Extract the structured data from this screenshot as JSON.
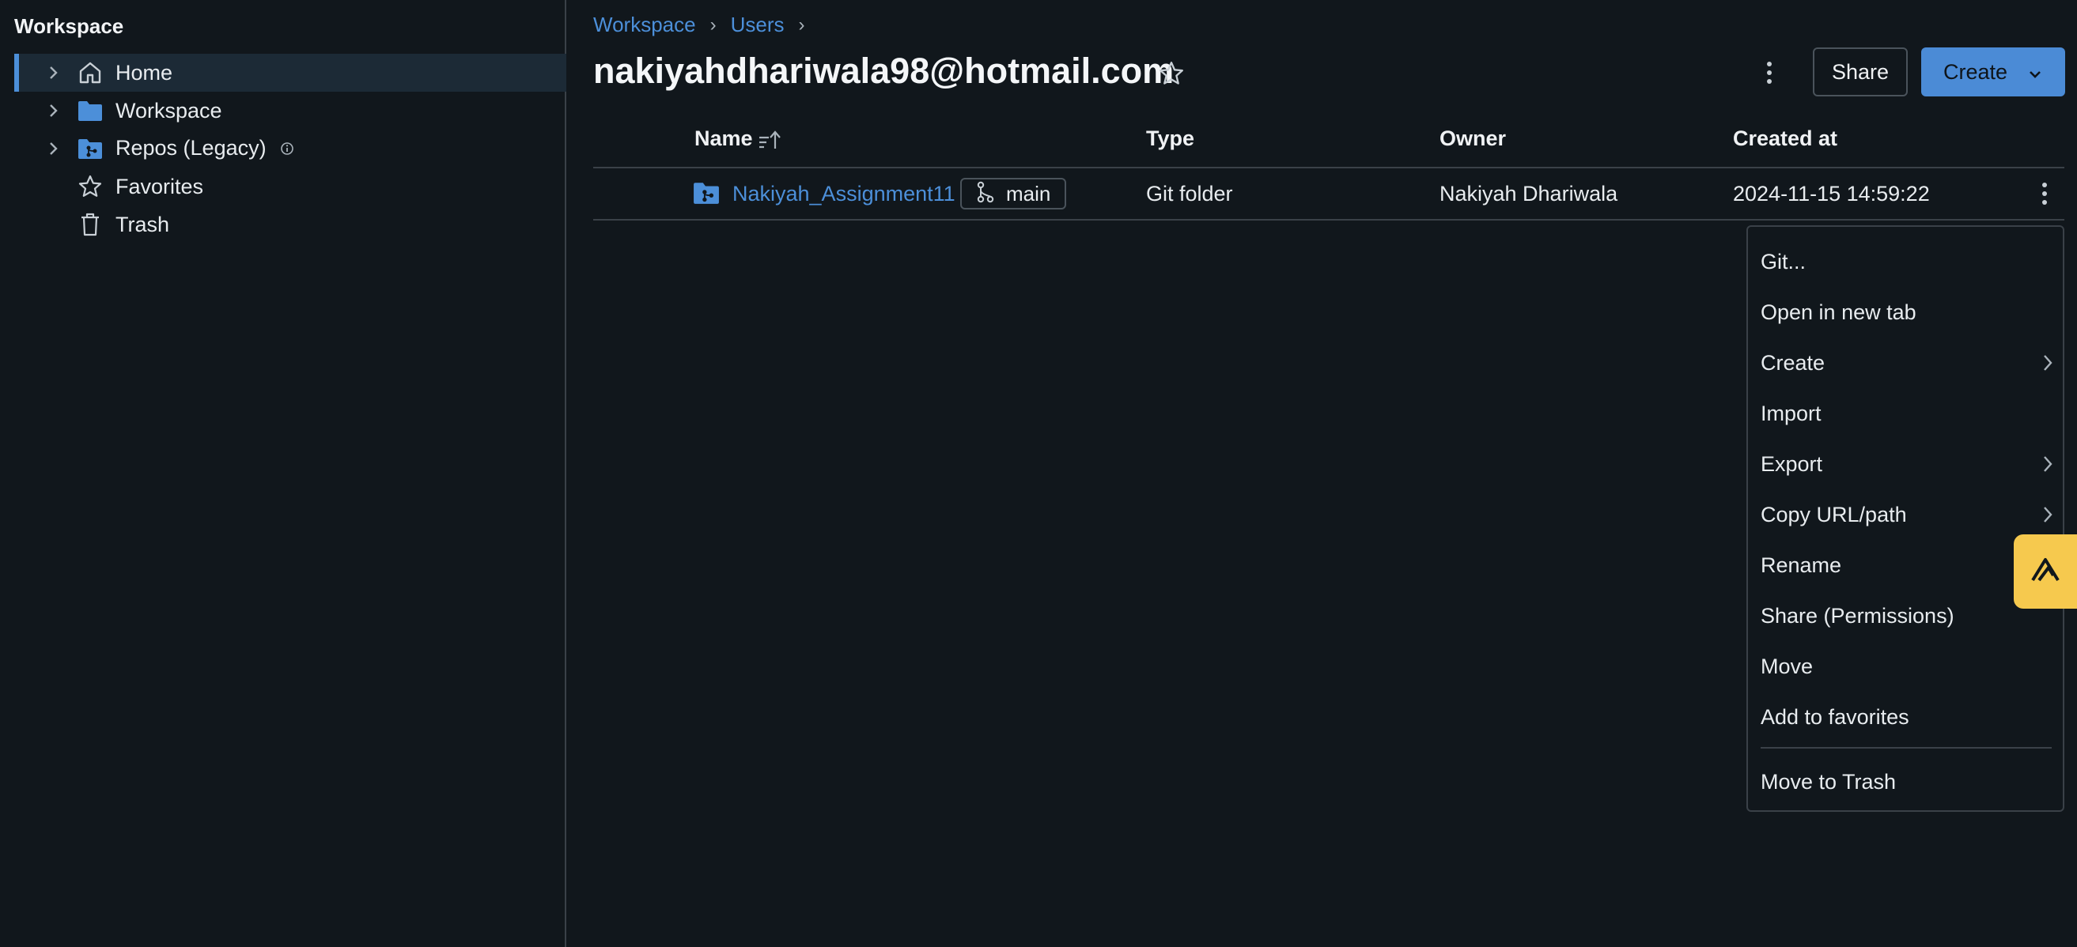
{
  "sidebar": {
    "title": "Workspace",
    "items": [
      {
        "label": "Home",
        "icon": "home-icon",
        "expandable": true,
        "selected": true
      },
      {
        "label": "Workspace",
        "icon": "folder-icon",
        "expandable": true
      },
      {
        "label": "Repos (Legacy)",
        "icon": "git-folder-icon",
        "expandable": true,
        "info_icon": "info-icon"
      },
      {
        "label": "Favorites",
        "icon": "star-icon",
        "expandable": false
      },
      {
        "label": "Trash",
        "icon": "trash-icon",
        "expandable": false
      }
    ]
  },
  "breadcrumb": {
    "items": [
      "Workspace",
      "Users"
    ]
  },
  "header": {
    "title": "nakiyahdhariwala98@hotmail.com",
    "share_label": "Share",
    "create_label": "Create"
  },
  "table": {
    "columns": {
      "name": "Name",
      "type": "Type",
      "owner": "Owner",
      "created": "Created at"
    },
    "rows": [
      {
        "name": "Nakiyah_Assignment11",
        "branch": "main",
        "type": "Git folder",
        "owner": "Nakiyah Dhariwala",
        "created": "2024-11-15 14:59:22"
      }
    ]
  },
  "context_menu": {
    "items": [
      {
        "label": "Git...",
        "submenu": false
      },
      {
        "label": "Open in new tab",
        "submenu": false
      },
      {
        "label": "Create",
        "submenu": true
      },
      {
        "label": "Import",
        "submenu": false
      },
      {
        "label": "Export",
        "submenu": true
      },
      {
        "label": "Copy URL/path",
        "submenu": true
      },
      {
        "label": "Rename",
        "submenu": false
      },
      {
        "label": "Share (Permissions)",
        "submenu": false
      },
      {
        "label": "Move",
        "submenu": false
      },
      {
        "label": "Add to favorites",
        "submenu": false
      }
    ],
    "trash_label": "Move to Trash"
  },
  "colors": {
    "background": "#11171c",
    "accent": "#4c8fd9",
    "primary_button": "#4b8bd6",
    "assistant_tab": "#f6c94e"
  }
}
